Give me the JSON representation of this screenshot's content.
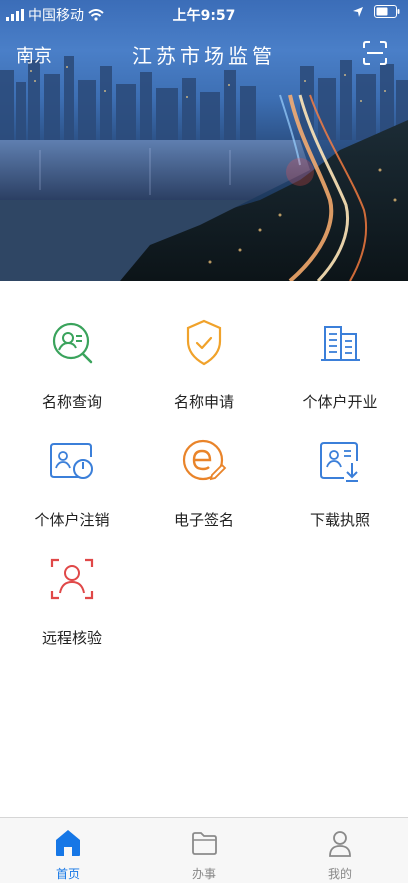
{
  "status_bar": {
    "carrier": "中国移动",
    "time": "上午9:57"
  },
  "header": {
    "city": "南京",
    "title": "江苏市场监管"
  },
  "services": [
    {
      "label": "名称查询",
      "icon": "name-search-icon",
      "color": "#3aa35c"
    },
    {
      "label": "名称申请",
      "icon": "shield-check-icon",
      "color": "#f0a22b"
    },
    {
      "label": "个体户开业",
      "icon": "building-icon",
      "color": "#3b7fd9"
    },
    {
      "label": "个体户注销",
      "icon": "id-card-power-icon",
      "color": "#3b7fd9"
    },
    {
      "label": "电子签名",
      "icon": "e-signature-icon",
      "color": "#e9842a"
    },
    {
      "label": "下载执照",
      "icon": "license-download-icon",
      "color": "#3b7fd9"
    },
    {
      "label": "远程核验",
      "icon": "face-verify-icon",
      "color": "#e04848"
    }
  ],
  "tabs": [
    {
      "label": "首页",
      "icon": "home-icon",
      "active": true
    },
    {
      "label": "办事",
      "icon": "folder-icon",
      "active": false
    },
    {
      "label": "我的",
      "icon": "user-icon",
      "active": false
    }
  ],
  "colors": {
    "accent": "#1677e6",
    "tab_inactive": "#888888"
  }
}
